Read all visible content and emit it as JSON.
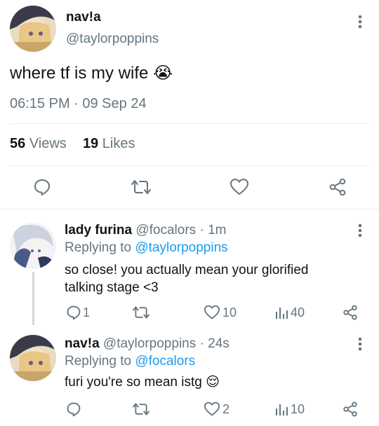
{
  "main_tweet": {
    "display_name": "nav!a",
    "handle": "@taylorpoppins",
    "text": "where tf is my wife",
    "emoji": "😭",
    "time": "06:15 PM · 09 Sep 24",
    "views_count": "56",
    "views_label": "Views",
    "likes_count": "19",
    "likes_label": "Likes"
  },
  "replies": [
    {
      "display_name": "lady furina",
      "handle": "@focalors",
      "time": "· 1m",
      "replying_prefix": "Replying to",
      "replying_to": "@taylorpoppins",
      "text": "so close! you actually mean your glorified talking stage <3",
      "reply_count": "1",
      "retweet_count": "",
      "like_count": "10",
      "view_count": "40"
    },
    {
      "display_name": "nav!a",
      "handle": "@taylorpoppins",
      "time": "· 24s",
      "replying_prefix": "Replying to",
      "replying_to": "@focalors",
      "text": "furi you're so mean istg",
      "emoji": "😌",
      "reply_count": "",
      "retweet_count": "",
      "like_count": "2",
      "view_count": "10"
    }
  ],
  "icons": {
    "reply": "speech-bubble-icon",
    "retweet": "retweet-icon",
    "like": "heart-icon",
    "share": "share-icon",
    "views": "bar-chart-icon",
    "more": "vertical-ellipsis-icon"
  },
  "colors": {
    "text": "#0f1419",
    "muted": "#66757f",
    "link": "#1d9bf0",
    "divider": "#e6ecf0"
  }
}
